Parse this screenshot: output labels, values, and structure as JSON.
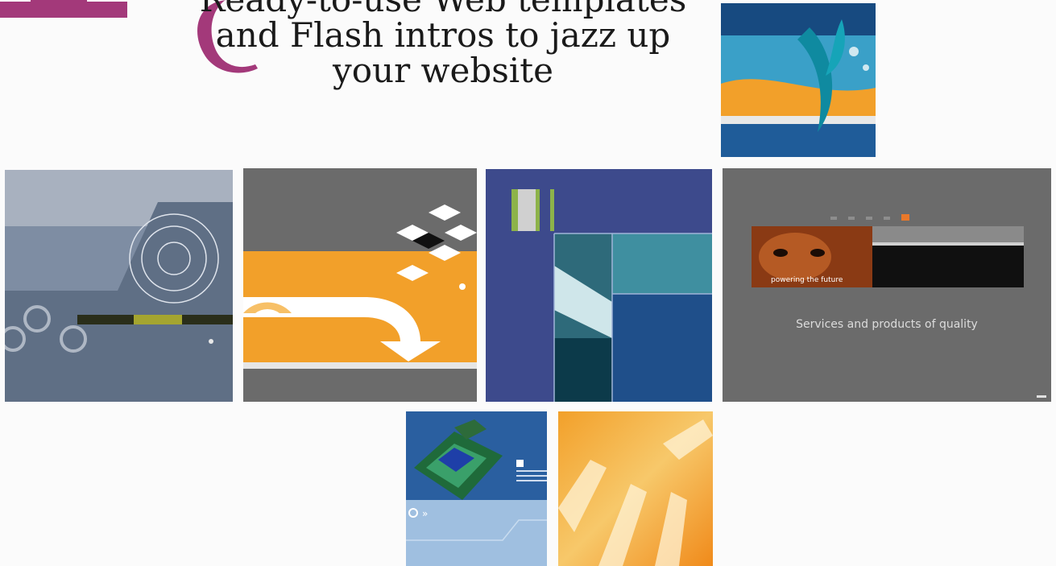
{
  "headline": {
    "line1": "Ready-to-use Web templates",
    "line2": "and Flash intros to jazz up",
    "line3": "your website"
  },
  "tiles": {
    "powering": {
      "caption": "powering the future",
      "slogan": "Services and products of quality"
    }
  },
  "colors": {
    "accent": "#a3397a",
    "orange": "#f2a02a",
    "navy": "#3d4a8c",
    "slate": "#5f6f85",
    "gray": "#6b6b6b",
    "blue": "#2a5fa0"
  }
}
